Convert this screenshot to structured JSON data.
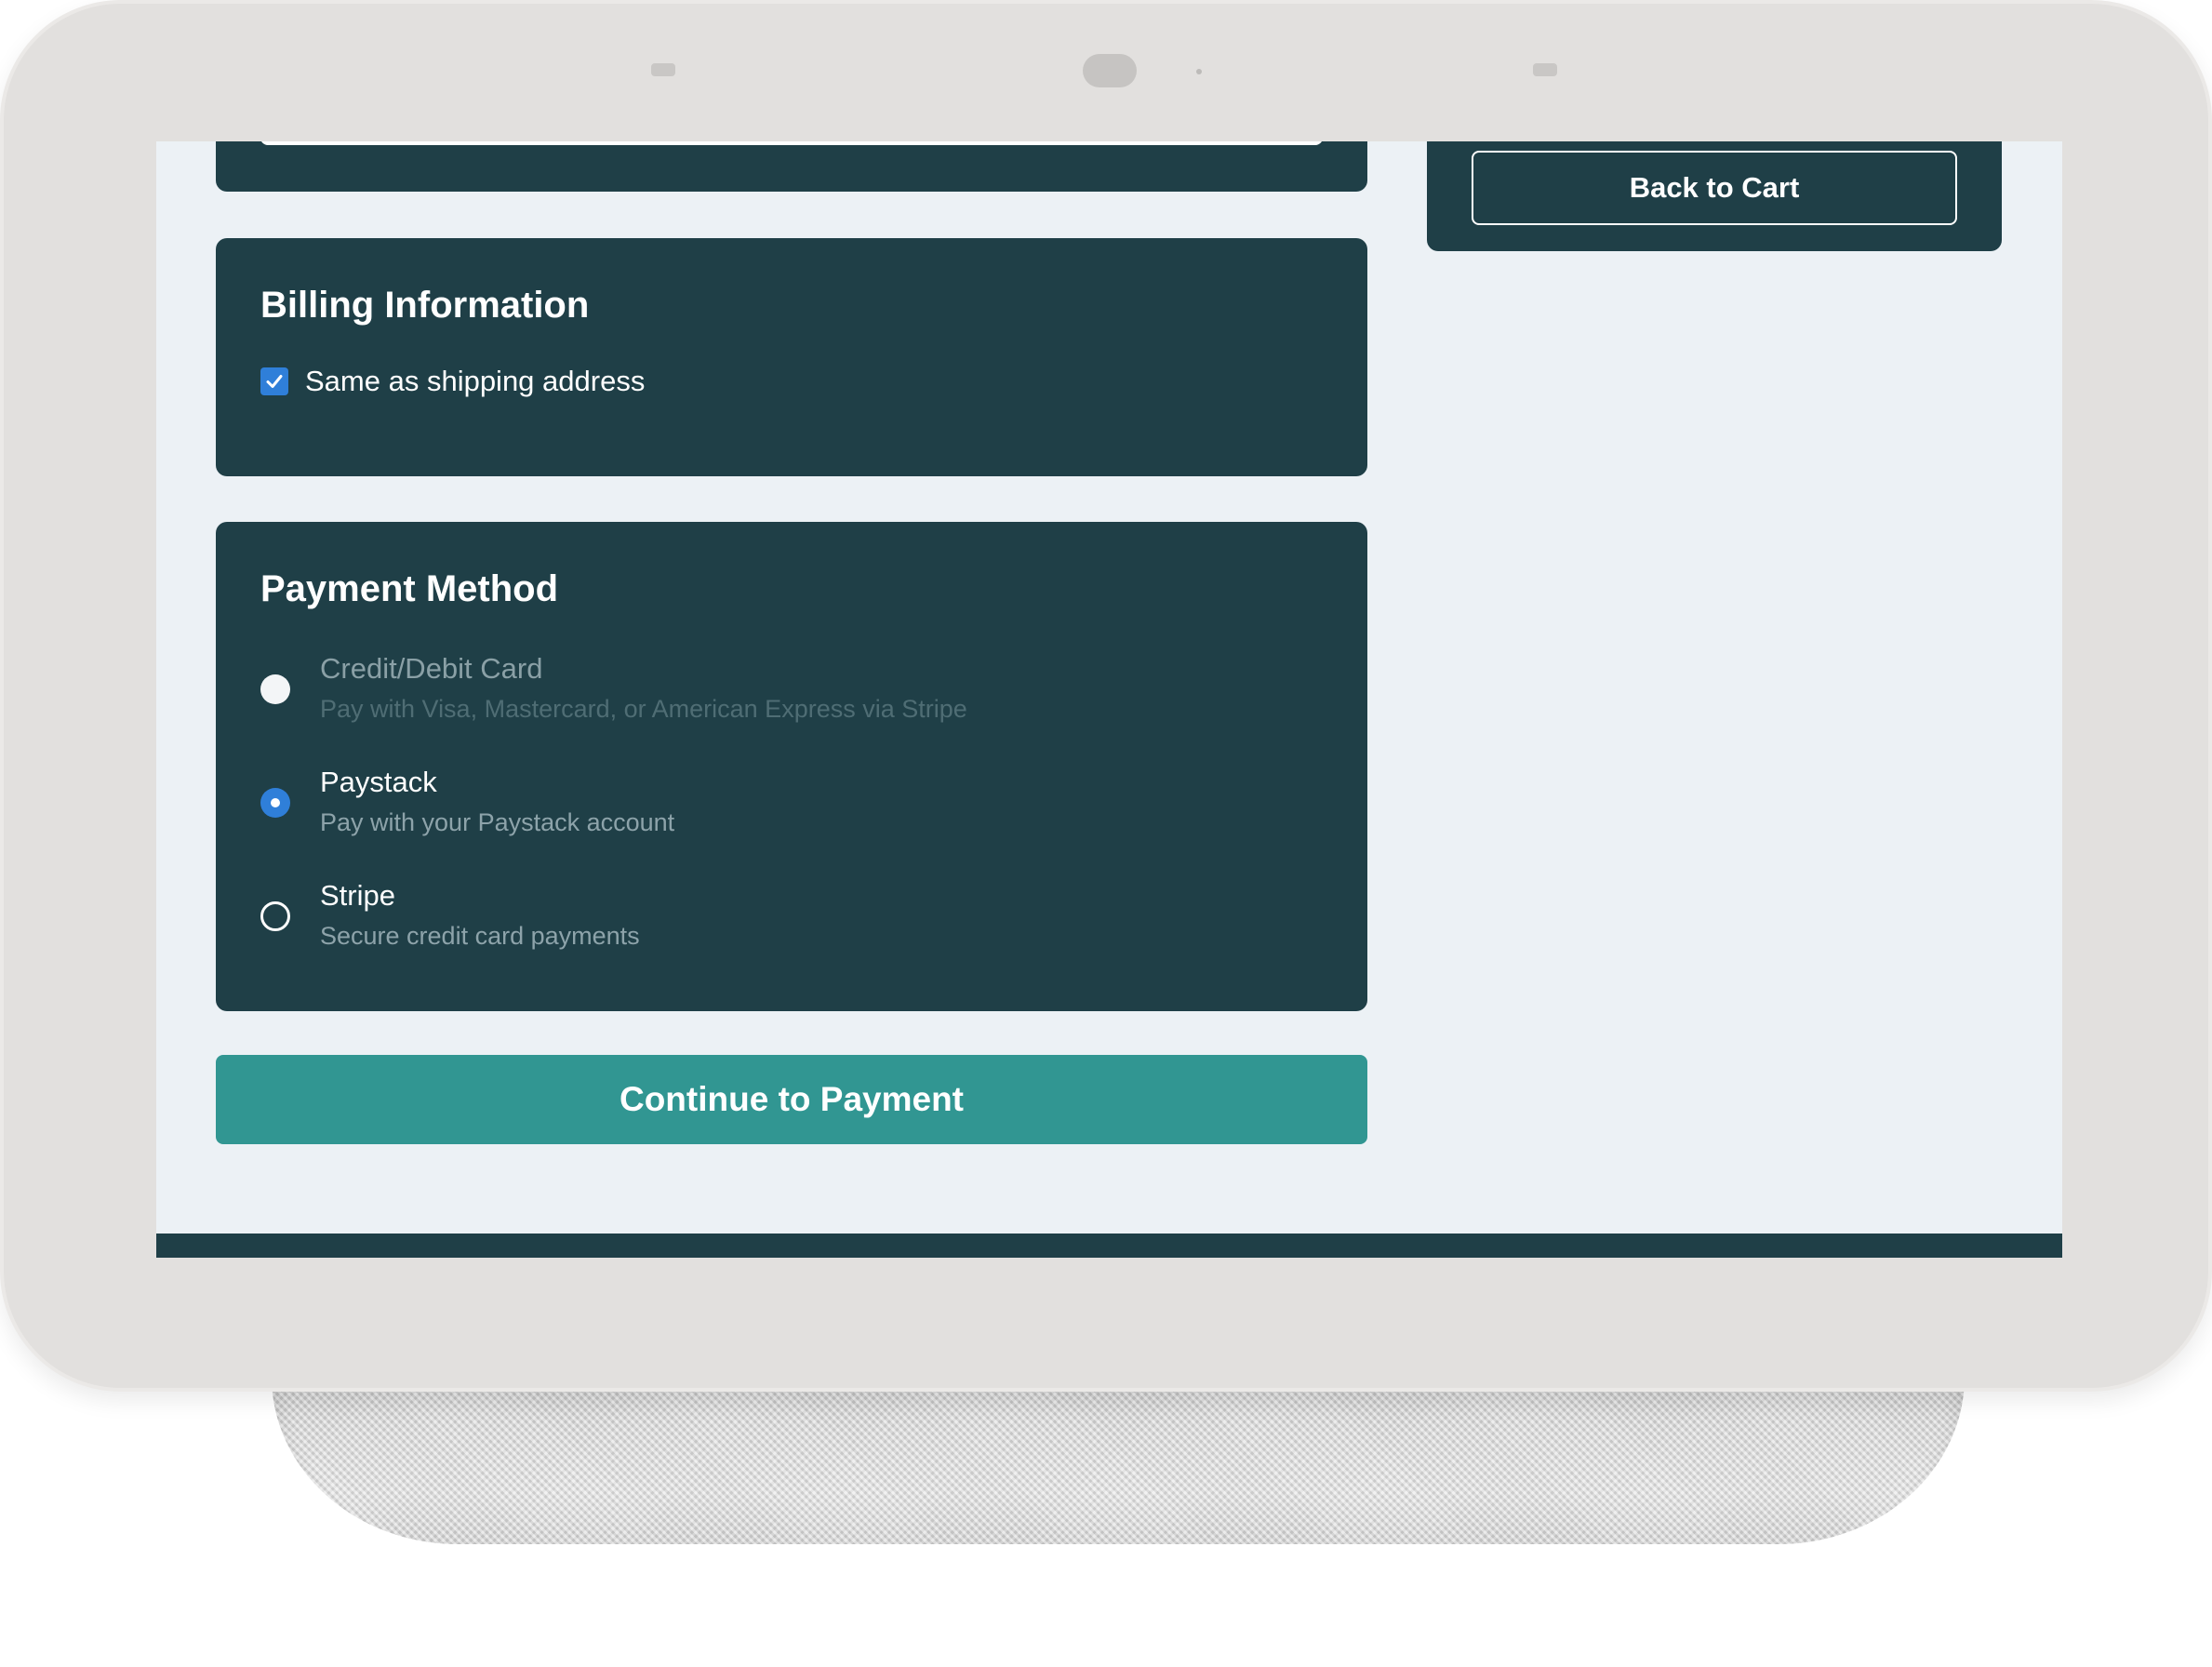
{
  "sidebar": {
    "back_to_cart_label": "Back to Cart"
  },
  "billing": {
    "title": "Billing Information",
    "same_as_shipping_label": "Same as shipping address",
    "same_as_shipping_checked": true
  },
  "payment": {
    "title": "Payment Method",
    "options": [
      {
        "label": "Credit/Debit Card",
        "description": "Pay with Visa, Mastercard, or American Express via Stripe",
        "state": "disabled"
      },
      {
        "label": "Paystack",
        "description": "Pay with your Paystack account",
        "state": "selected"
      },
      {
        "label": "Stripe",
        "description": "Secure credit card payments",
        "state": "unselected"
      }
    ]
  },
  "actions": {
    "continue_label": "Continue to Payment"
  },
  "colors": {
    "card_bg": "#1f3f47",
    "page_bg": "#ecf1f5",
    "accent_button": "#319692",
    "selected_blue": "#2f7fd9"
  },
  "icons": {
    "checkbox": "check-icon"
  }
}
